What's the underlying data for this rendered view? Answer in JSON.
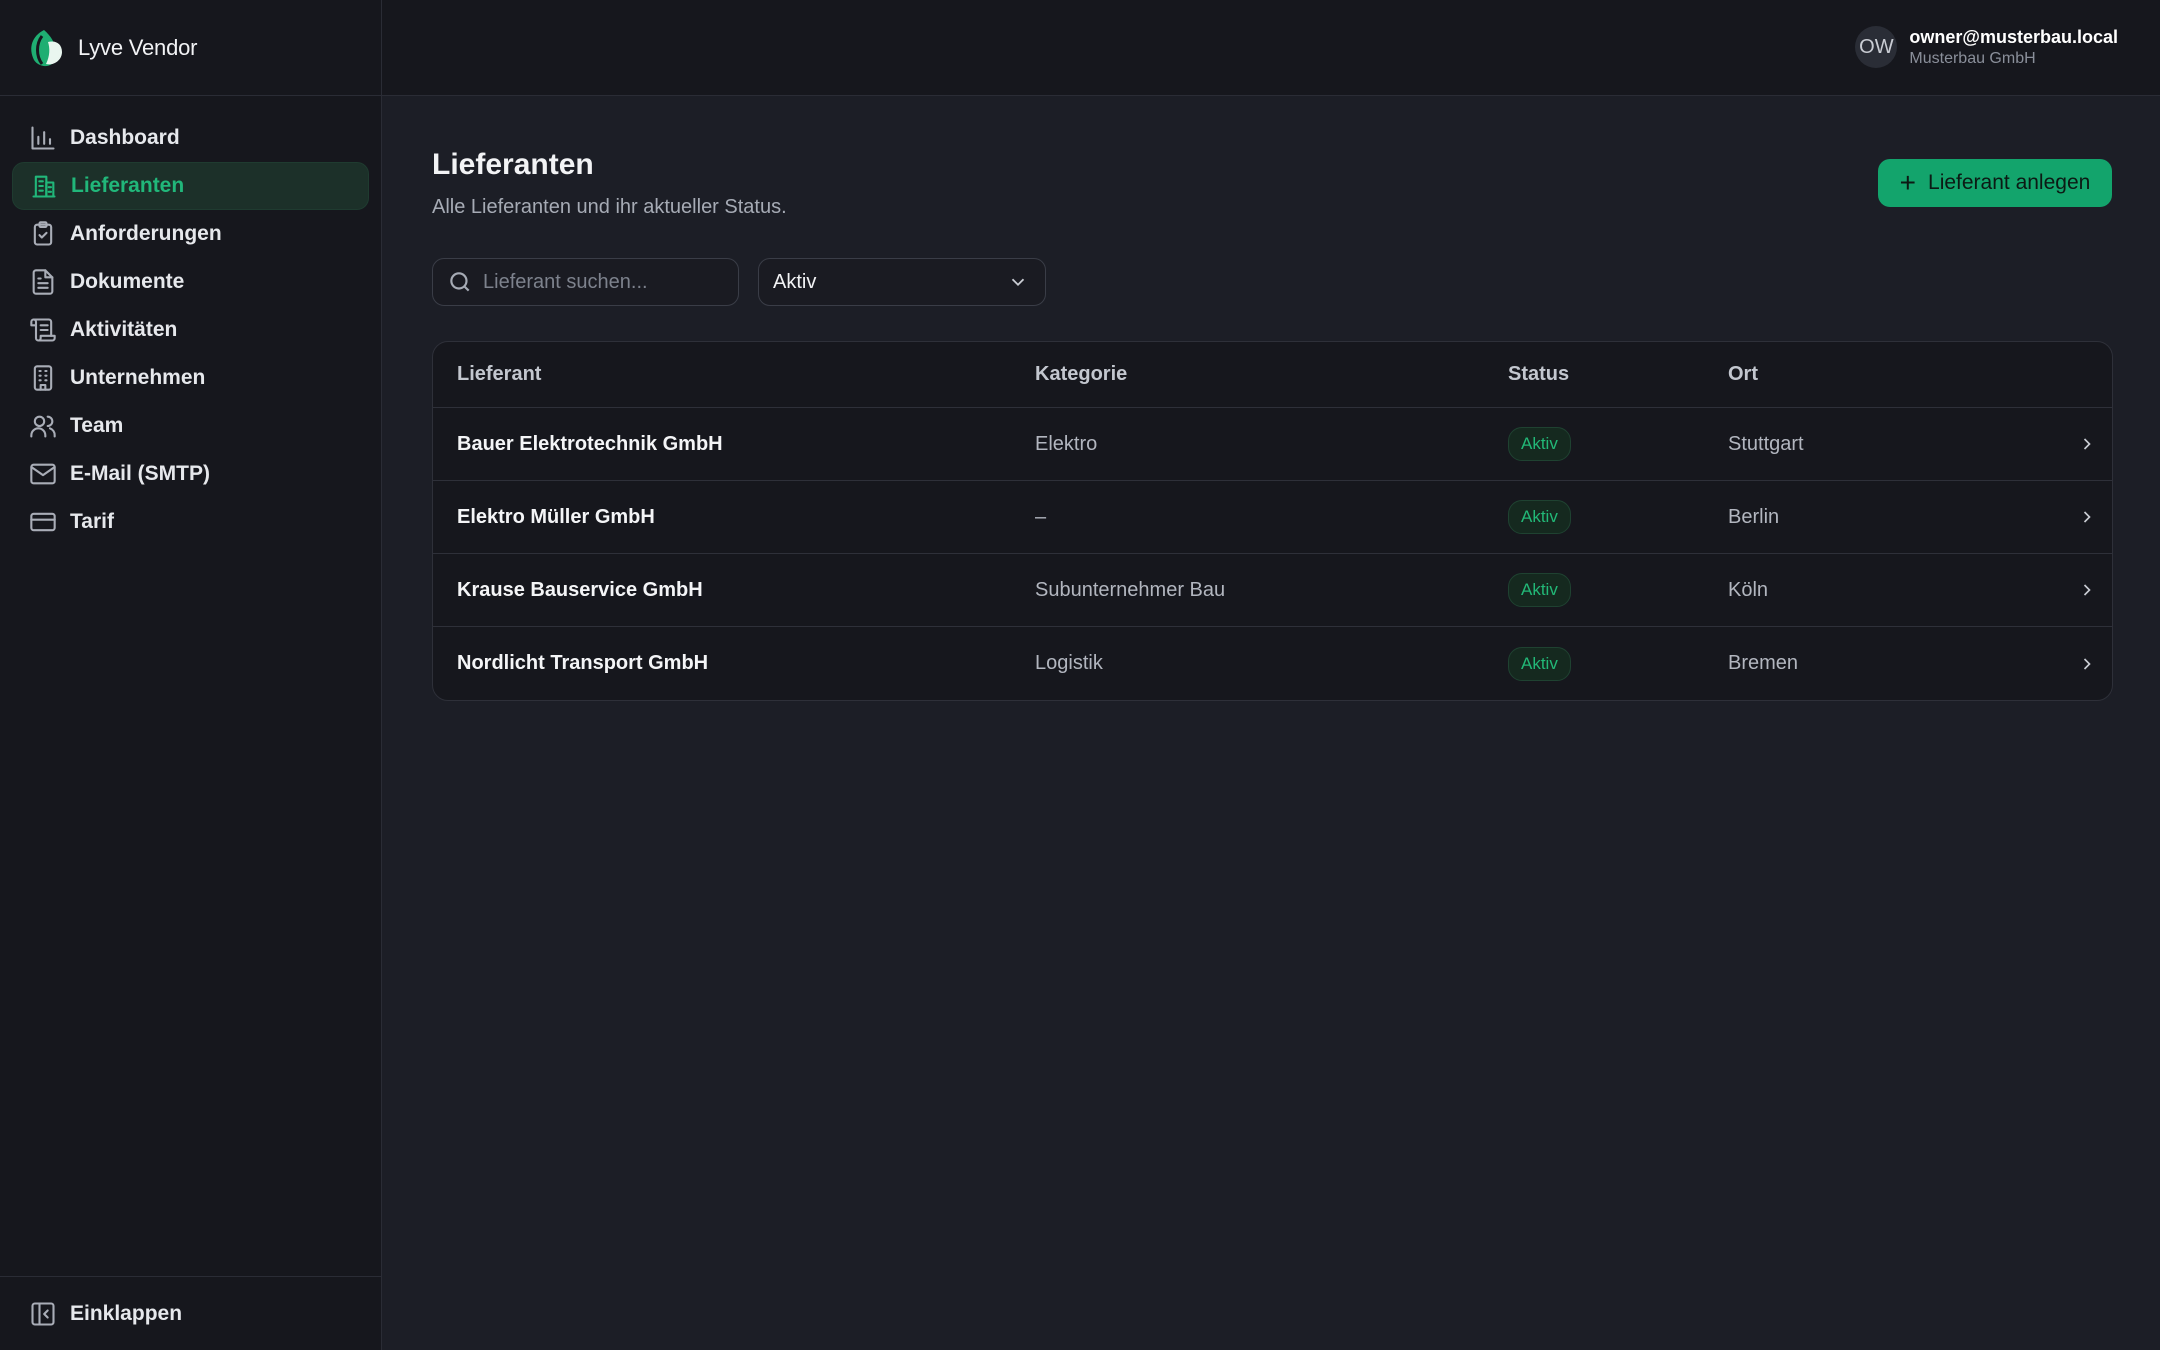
{
  "app": {
    "name": "Lyve Vendor",
    "accent": "#13a46c",
    "active_color": "#21b77a"
  },
  "sidebar": {
    "items": [
      {
        "label": "Dashboard",
        "icon": "bar-chart-icon"
      },
      {
        "label": "Lieferanten",
        "icon": "building-icon",
        "active": true
      },
      {
        "label": "Anforderungen",
        "icon": "clipboard-check-icon"
      },
      {
        "label": "Dokumente",
        "icon": "document-icon"
      },
      {
        "label": "Aktivitäten",
        "icon": "scroll-icon"
      },
      {
        "label": "Unternehmen",
        "icon": "office-building-icon"
      },
      {
        "label": "Team",
        "icon": "users-icon"
      },
      {
        "label": "E-Mail (SMTP)",
        "icon": "mail-icon"
      },
      {
        "label": "Tarif",
        "icon": "credit-card-icon"
      }
    ],
    "collapse_label": "Einklappen"
  },
  "header": {
    "avatar_initials": "OW",
    "user_email": "owner@musterbau.local",
    "user_org": "Musterbau GmbH"
  },
  "main": {
    "title": "Lieferanten",
    "subtitle": "Alle Lieferanten und ihr aktueller Status.",
    "add_button": "Lieferant anlegen",
    "search_placeholder": "Lieferant suchen...",
    "status_filter": "Aktiv",
    "table": {
      "columns": [
        "Lieferant",
        "Kategorie",
        "Status",
        "Ort"
      ],
      "rows": [
        {
          "name": "Bauer Elektrotechnik GmbH",
          "category": "Elektro",
          "status": "Aktiv",
          "city": "Stuttgart"
        },
        {
          "name": "Elektro Müller GmbH",
          "category": "–",
          "status": "Aktiv",
          "city": "Berlin"
        },
        {
          "name": "Krause Bauservice GmbH",
          "category": "Subunternehmer Bau",
          "status": "Aktiv",
          "city": "Köln"
        },
        {
          "name": "Nordlicht Transport GmbH",
          "category": "Logistik",
          "status": "Aktiv",
          "city": "Bremen"
        }
      ]
    }
  }
}
